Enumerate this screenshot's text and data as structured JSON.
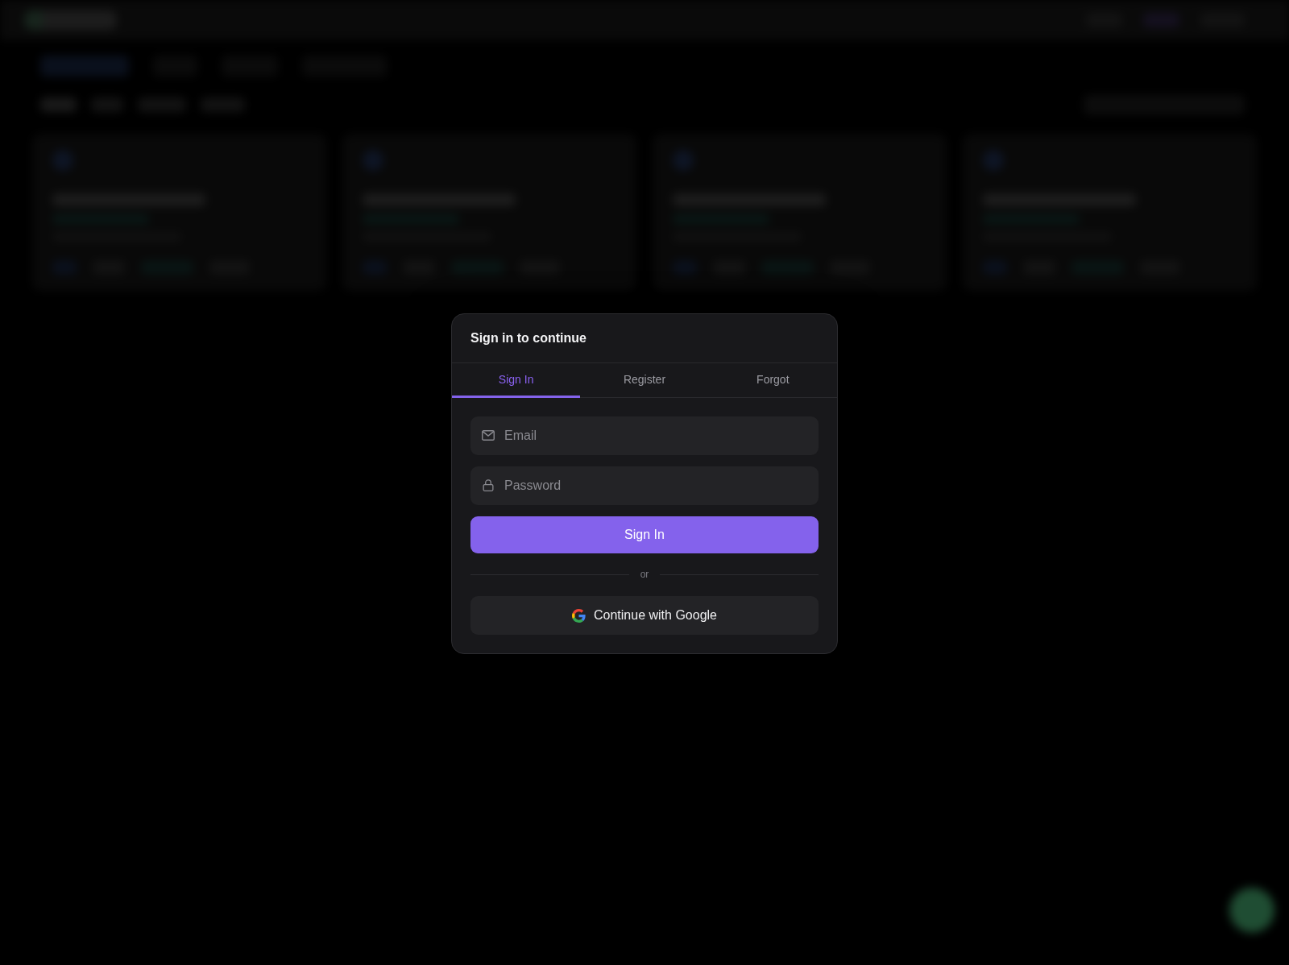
{
  "dialog": {
    "title": "Sign in to continue"
  },
  "tabs": [
    {
      "label": "Sign In",
      "selected": true
    },
    {
      "label": "Register",
      "selected": false
    },
    {
      "label": "Forgot",
      "selected": false
    }
  ],
  "fields": [
    {
      "kind": "email",
      "placeholder": "Email"
    },
    {
      "kind": "password",
      "placeholder": "Password"
    }
  ],
  "submit_button": {
    "label": "Sign In"
  },
  "divider": {
    "label": "or"
  },
  "google_button": {
    "label": "Continue with Google"
  }
}
